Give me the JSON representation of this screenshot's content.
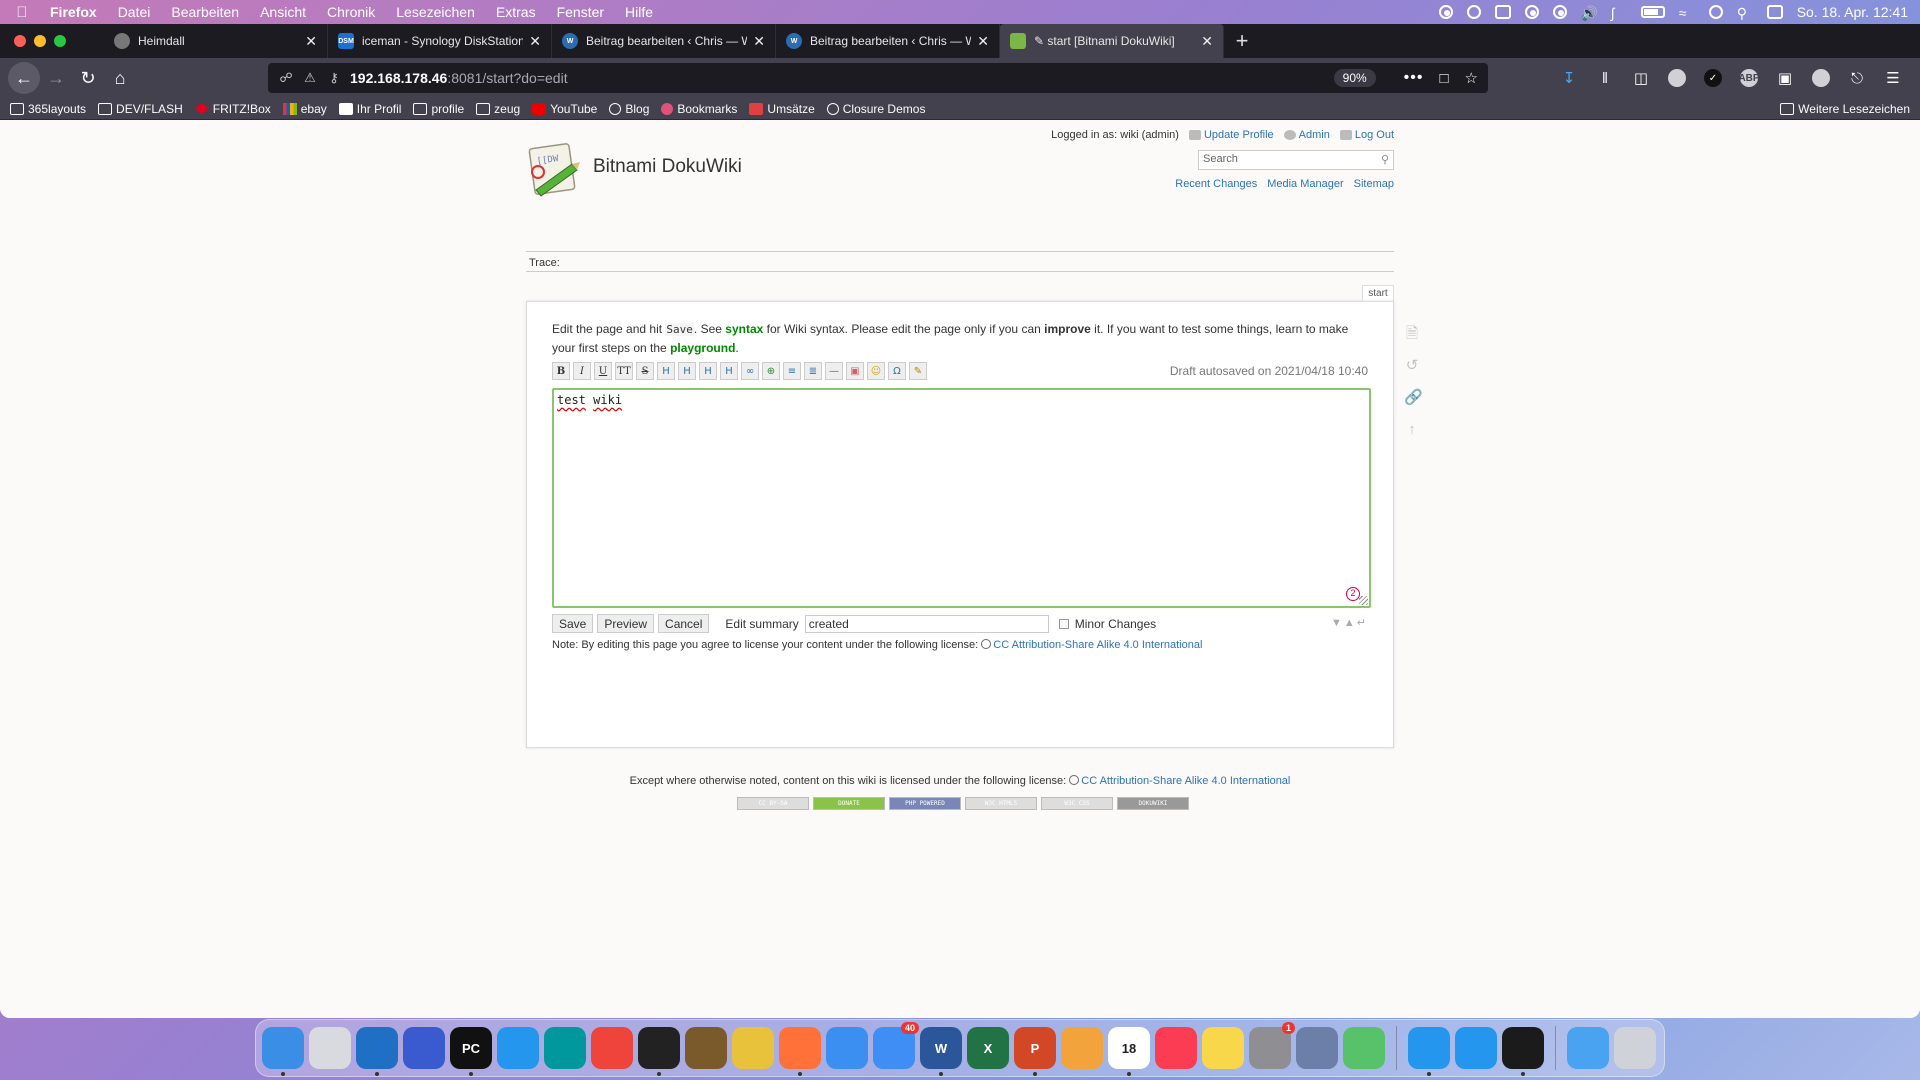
{
  "menubar": {
    "app_name": "Firefox",
    "items": [
      "Datei",
      "Bearbeiten",
      "Ansicht",
      "Chronik",
      "Lesezeichen",
      "Extras",
      "Fenster",
      "Hilfe"
    ],
    "clock": "So. 18. Apr.  12:41"
  },
  "tabs": [
    {
      "label": "Heimdall",
      "favicon_color": "#777777"
    },
    {
      "label": "iceman - Synology DiskStation",
      "favicon_text": "DSM",
      "favicon_color": "#1d6fd0"
    },
    {
      "label": "Beitrag bearbeiten ‹ Chris — W",
      "favicon_color": "#2b6cb0"
    },
    {
      "label": "Beitrag bearbeiten ‹ Chris — W",
      "favicon_color": "#2b6cb0"
    },
    {
      "label": "✎ start [Bitnami DokuWiki]",
      "favicon_color": "#7ab648",
      "active": true
    }
  ],
  "urlbar": {
    "host": "192.168.178.46",
    "path": ":8081/start?do=edit",
    "zoom": "90%"
  },
  "bookmarks": [
    {
      "label": "365layouts",
      "icon": "folder"
    },
    {
      "label": "DEV/FLASH",
      "icon": "folder"
    },
    {
      "label": "FRITZ!Box",
      "icon": "fritz"
    },
    {
      "label": "ebay",
      "icon": "ebay"
    },
    {
      "label": "Ihr Profil",
      "icon": "amazon"
    },
    {
      "label": "profile",
      "icon": "folder"
    },
    {
      "label": "zeug",
      "icon": "folder"
    },
    {
      "label": "YouTube",
      "icon": "yt"
    },
    {
      "label": "Blog",
      "icon": "globe"
    },
    {
      "label": "Bookmarks",
      "icon": "bk"
    },
    {
      "label": "Umsätze",
      "icon": "um"
    },
    {
      "label": "Closure Demos",
      "icon": "globe"
    }
  ],
  "bookmarks_more": "Weitere Lesezeichen",
  "wiki": {
    "title": "Bitnami DokuWiki",
    "logged_in": "Logged in as: wiki (admin)",
    "user_tools": [
      "Update Profile",
      "Admin",
      "Log Out"
    ],
    "search_placeholder": "Search",
    "site_tools": [
      "Recent Changes",
      "Media Manager",
      "Sitemap"
    ],
    "trace_label": "Trace:",
    "page_id": "start",
    "intro": {
      "part1": "Edit the page and hit ",
      "save_code": "Save",
      "part2": ". See ",
      "syntax_link": "syntax",
      "part3": " for Wiki syntax. Please edit the page only if you can ",
      "improve": "improve",
      "part4": " it. If you want to test some things, learn to make your first steps on the ",
      "playground_link": "playground",
      "part5": "."
    },
    "toolbar_buttons": [
      "B",
      "I",
      "U",
      "TT",
      "S",
      "H",
      "H",
      "H",
      "H",
      "∞",
      "⊕",
      "≡",
      "≣",
      "—",
      "▣",
      "☺",
      "Ω",
      "✎"
    ],
    "draft_note": "Draft autosaved on 2021/04/18 10:40",
    "editor_words": [
      "test",
      "wiki"
    ],
    "editor_badge": "2",
    "buttons": {
      "save": "Save",
      "preview": "Preview",
      "cancel": "Cancel"
    },
    "summary_label": "Edit summary",
    "summary_value": "created",
    "minor_changes": "Minor Changes",
    "license_note": "Note: By editing this page you agree to license your content under the following license:",
    "license_link": "CC Attribution-Share Alike 4.0 International",
    "footer_text": "Except where otherwise noted, content on this wiki is licensed under the following license:",
    "footer_link": "CC Attribution-Share Alike 4.0 International",
    "badges": [
      "CC BY-SA",
      "DONATE",
      "PHP POWERED",
      "W3C HTML5",
      "W3C CSS",
      "DOKUWIKI"
    ]
  },
  "dock": [
    {
      "name": "finder",
      "color": "#3a8ee6"
    },
    {
      "name": "launchpad",
      "color": "#d9d9e0"
    },
    {
      "name": "vscode",
      "color": "#1f6fc4"
    },
    {
      "name": "app-blue",
      "color": "#3a5bd0"
    },
    {
      "name": "pycharm",
      "color": "#111111",
      "text": "PC"
    },
    {
      "name": "docker",
      "color": "#2496ed"
    },
    {
      "name": "arduino",
      "color": "#00979d"
    },
    {
      "name": "anydesk",
      "color": "#ef443b"
    },
    {
      "name": "terminal-dark",
      "color": "#222222"
    },
    {
      "name": "calibre",
      "color": "#7a5a2a"
    },
    {
      "name": "chrome",
      "color": "#e8c23a"
    },
    {
      "name": "firefox",
      "color": "#ff7139"
    },
    {
      "name": "safari",
      "color": "#3b8ff0"
    },
    {
      "name": "mail",
      "color": "#3f8ef5",
      "badge": "40"
    },
    {
      "name": "word",
      "color": "#2b579a",
      "text": "W"
    },
    {
      "name": "excel",
      "color": "#217346",
      "text": "X"
    },
    {
      "name": "powerpoint",
      "color": "#d24726",
      "text": "P"
    },
    {
      "name": "photos",
      "color": "#f3a33c"
    },
    {
      "name": "calendar",
      "color": "#ffffff",
      "text": "18"
    },
    {
      "name": "music",
      "color": "#fb3c52"
    },
    {
      "name": "notes",
      "color": "#f8d74a"
    },
    {
      "name": "system-preferences",
      "color": "#8e8e93",
      "badge": "1"
    },
    {
      "name": "preview",
      "color": "#6b7fa8"
    },
    {
      "name": "cube-app",
      "color": "#58c26b"
    },
    {
      "name": "docker-2",
      "color": "#2496ed"
    },
    {
      "name": "docker-3",
      "color": "#2496ed"
    },
    {
      "name": "terminal",
      "color": "#1b1b1b"
    },
    {
      "name": "downloads-folder",
      "color": "#4aa3f0"
    },
    {
      "name": "trash",
      "color": "#cfd2d8"
    }
  ]
}
